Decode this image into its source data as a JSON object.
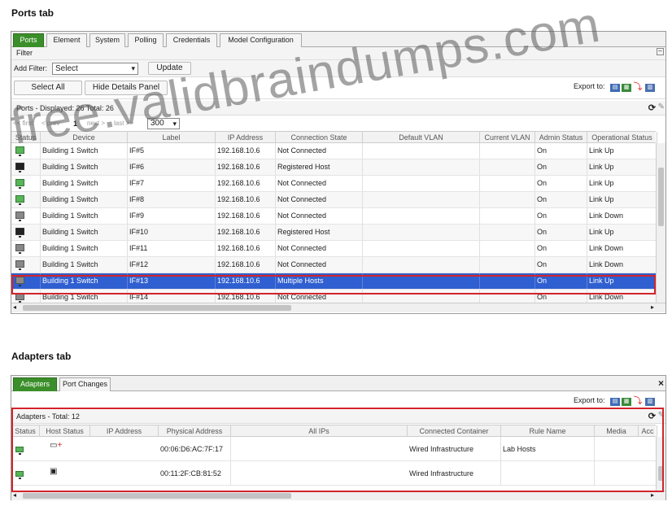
{
  "ports_section": {
    "title": "Ports tab",
    "tabs": [
      "Ports",
      "Element",
      "System",
      "Polling",
      "Credentials",
      "Model Configuration"
    ],
    "filter_label": "Filter",
    "add_filter_label": "Add Filter:",
    "add_filter_value": "Select",
    "update_label": "Update",
    "select_all_label": "Select All",
    "hide_details_label": "Hide Details Panel",
    "export_label": "Export to:",
    "summary": "Ports - Displayed: 26 Total: 26",
    "pager": {
      "first": "<< first",
      "prev": "< prev",
      "page": "1",
      "next": "next >",
      "last": "last >>",
      "page_size": "300"
    },
    "columns": [
      "Status",
      "Device",
      "Label",
      "IP Address",
      "Connection State",
      "Default VLAN",
      "Current VLAN",
      "Admin Status",
      "Operational Status"
    ],
    "rows": [
      {
        "status_icon": "green",
        "device": "Building 1 Switch",
        "label": "IF#5",
        "ip": "192.168.10.6",
        "conn": "Not Connected",
        "admin": "On",
        "oper": "Link Up"
      },
      {
        "status_icon": "dark",
        "device": "Building 1 Switch",
        "label": "IF#6",
        "ip": "192.168.10.6",
        "conn": "Registered Host",
        "admin": "On",
        "oper": "Link Up"
      },
      {
        "status_icon": "green",
        "device": "Building 1 Switch",
        "label": "IF#7",
        "ip": "192.168.10.6",
        "conn": "Not Connected",
        "admin": "On",
        "oper": "Link Up"
      },
      {
        "status_icon": "green",
        "device": "Building 1 Switch",
        "label": "IF#8",
        "ip": "192.168.10.6",
        "conn": "Not Connected",
        "admin": "On",
        "oper": "Link Up"
      },
      {
        "status_icon": "gray",
        "device": "Building 1 Switch",
        "label": "IF#9",
        "ip": "192.168.10.6",
        "conn": "Not Connected",
        "admin": "On",
        "oper": "Link Down"
      },
      {
        "status_icon": "dark",
        "device": "Building 1 Switch",
        "label": "IF#10",
        "ip": "192.168.10.6",
        "conn": "Registered Host",
        "admin": "On",
        "oper": "Link Up"
      },
      {
        "status_icon": "gray",
        "device": "Building 1 Switch",
        "label": "IF#11",
        "ip": "192.168.10.6",
        "conn": "Not Connected",
        "admin": "On",
        "oper": "Link Down"
      },
      {
        "status_icon": "gray",
        "device": "Building 1 Switch",
        "label": "IF#12",
        "ip": "192.168.10.6",
        "conn": "Not Connected",
        "admin": "On",
        "oper": "Link Down"
      },
      {
        "status_icon": "gray",
        "device": "Building 1 Switch",
        "label": "IF#13",
        "ip": "192.168.10.6",
        "conn": "Multiple Hosts",
        "admin": "On",
        "oper": "Link Up"
      },
      {
        "status_icon": "gray",
        "device": "Building 1 Switch",
        "label": "IF#14",
        "ip": "192.168.10.6",
        "conn": "Not Connected",
        "admin": "On",
        "oper": "Link Down"
      }
    ]
  },
  "adapters_section": {
    "title": "Adapters tab",
    "tabs": [
      "Adapters",
      "Port Changes"
    ],
    "close_label": "×",
    "export_label": "Export to:",
    "summary": "Adapters - Total: 12",
    "columns": [
      "Status",
      "Host Status",
      "IP Address",
      "Physical Address",
      "All IPs",
      "Connected Container",
      "Rule Name",
      "Media",
      "Acc"
    ],
    "rows": [
      {
        "mac": "00:06:D6:AC:7F:17",
        "container": "Wired Infrastructure",
        "rule": "Lab Hosts"
      },
      {
        "mac": "00:11:2F:CB:81:52",
        "container": "Wired Infrastructure",
        "rule": ""
      }
    ]
  },
  "watermark": "free.validbraindumps.com",
  "colors": {
    "active_tab": "#3b8f2a",
    "selection": "#2f5fd0",
    "highlight_box": "#d3242c"
  }
}
